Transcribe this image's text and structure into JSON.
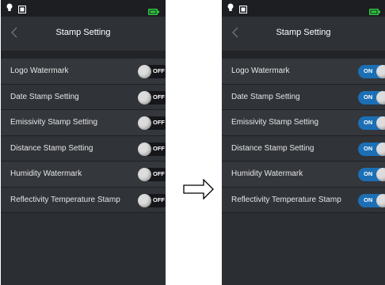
{
  "colors": {
    "on_toggle": "#1c6fb5",
    "off_toggle": "#15171a",
    "background": "#2b2e33",
    "battery": "#2ecc40"
  },
  "icons": {
    "status": [
      "lightbulb-icon",
      "gallery-icon",
      "battery-icon"
    ],
    "back": "chevron-left-icon",
    "between": "right-arrow-icon"
  },
  "left_screen": {
    "title": "Stamp Setting",
    "items": [
      {
        "label": "Logo Watermark",
        "state": "OFF"
      },
      {
        "label": "Date Stamp Setting",
        "state": "OFF"
      },
      {
        "label": "Emissivity Stamp Setting",
        "state": "OFF"
      },
      {
        "label": "Distance Stamp Setting",
        "state": "OFF"
      },
      {
        "label": "Humidity Watermark",
        "state": "OFF"
      },
      {
        "label": "Reflectivity Temperature Stamp",
        "state": "OFF"
      }
    ]
  },
  "right_screen": {
    "title": "Stamp Setting",
    "items": [
      {
        "label": "Logo Watermark",
        "state": "ON"
      },
      {
        "label": "Date Stamp Setting",
        "state": "ON"
      },
      {
        "label": "Emissivity Stamp Setting",
        "state": "ON"
      },
      {
        "label": "Distance Stamp Setting",
        "state": "ON"
      },
      {
        "label": "Humidity Watermark",
        "state": "ON"
      },
      {
        "label": "Reflectivity Temperature Stamp",
        "state": "ON"
      }
    ]
  }
}
